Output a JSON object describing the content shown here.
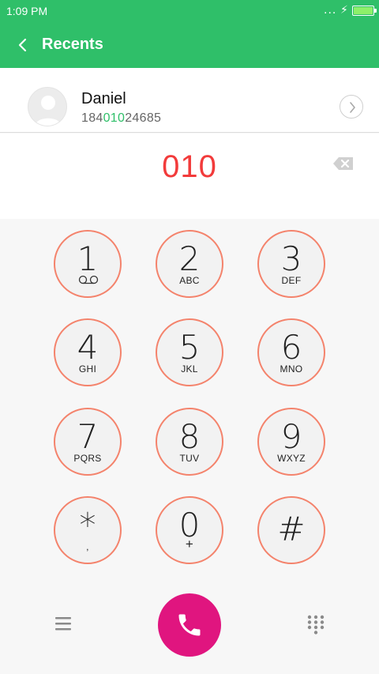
{
  "status_bar": {
    "time": "1:09 PM",
    "signal_dots": "..."
  },
  "header": {
    "title": "Recents"
  },
  "contact": {
    "name": "Daniel",
    "number_prefix": "184",
    "number_match": "010",
    "number_suffix": "24685"
  },
  "dialer": {
    "entered": "010"
  },
  "keys": [
    {
      "num": "1",
      "sub": ""
    },
    {
      "num": "2",
      "sub": "ABC"
    },
    {
      "num": "3",
      "sub": "DEF"
    },
    {
      "num": "4",
      "sub": "GHI"
    },
    {
      "num": "5",
      "sub": "JKL"
    },
    {
      "num": "6",
      "sub": "MNO"
    },
    {
      "num": "7",
      "sub": "PQRS"
    },
    {
      "num": "8",
      "sub": "TUV"
    },
    {
      "num": "9",
      "sub": "WXYZ"
    },
    {
      "num": "*",
      "sub": ","
    },
    {
      "num": "0",
      "sub": "+"
    },
    {
      "num": "#",
      "sub": ""
    }
  ],
  "icons": {
    "back": "chevron-left-icon",
    "delete": "backspace-icon",
    "menu": "menu-icon",
    "call": "phone-icon",
    "dialpad": "dialpad-icon",
    "voicemail": "voicemail-icon"
  },
  "colors": {
    "header_green": "#2fbf69",
    "accent_red": "#f23b3b",
    "key_ring": "#f4836c",
    "call_button": "#e0157f"
  }
}
